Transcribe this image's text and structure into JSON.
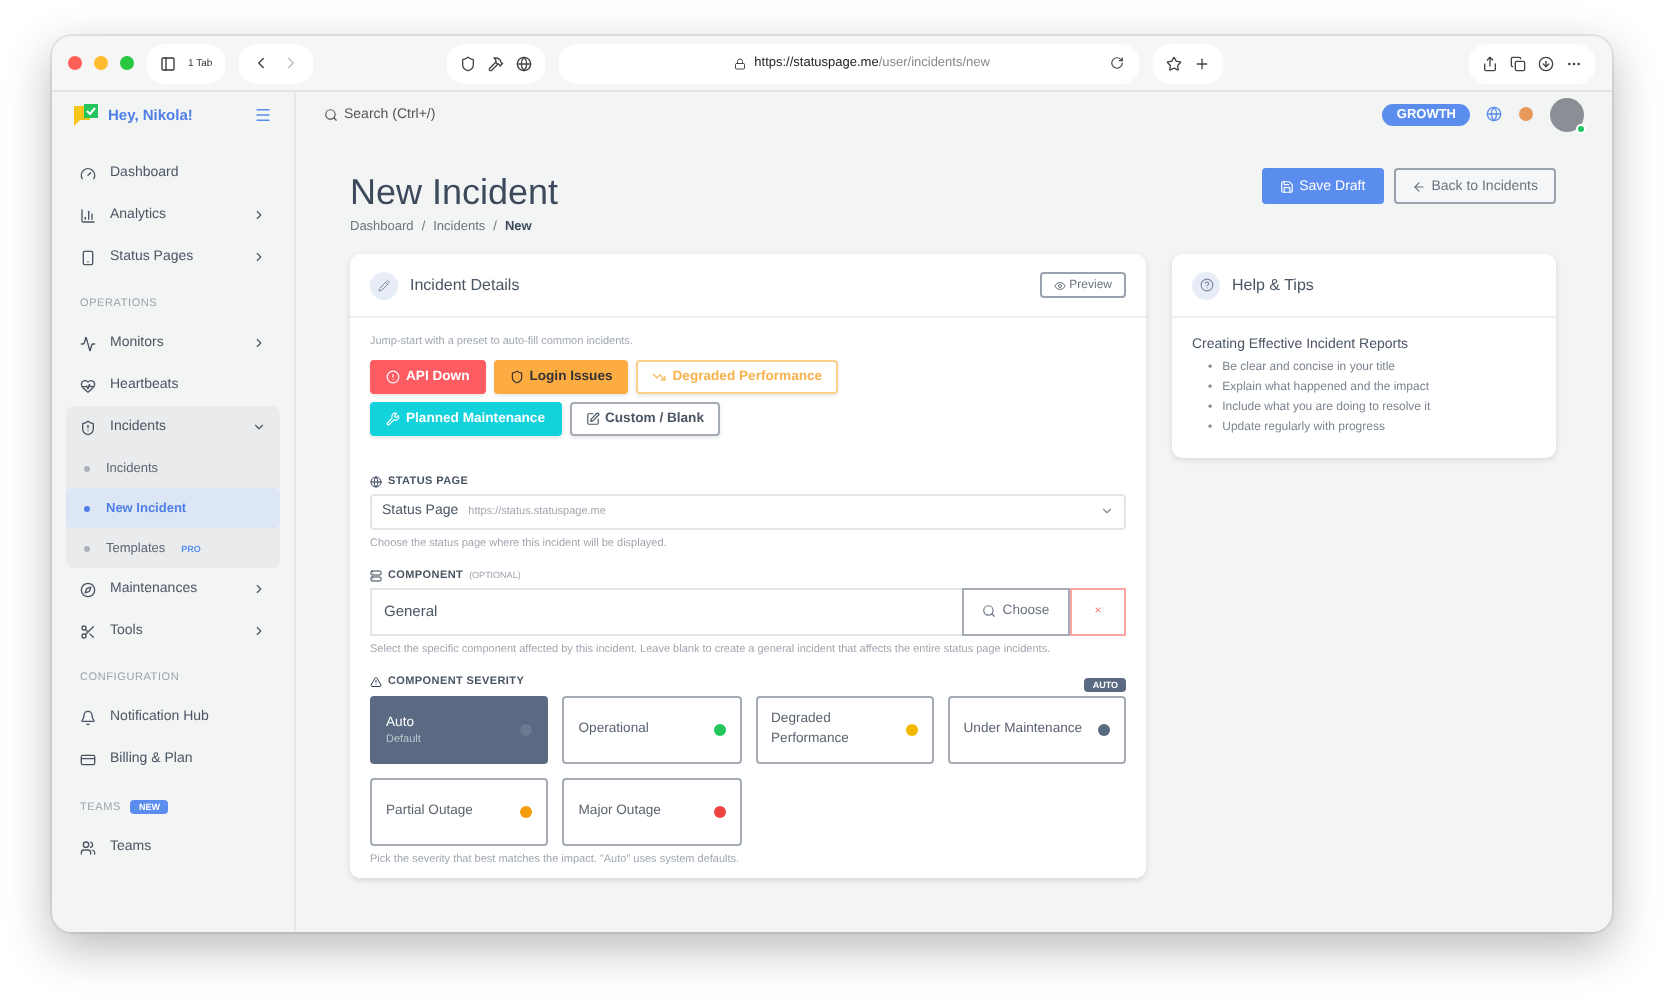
{
  "browser": {
    "tab_count": "1 Tab",
    "url_host": "https://statuspage.me",
    "url_path": "/user/incidents/new"
  },
  "sidebar": {
    "greeting": "Hey, Nikola!",
    "groups": [
      {
        "items": [
          {
            "label": "Dashboard",
            "expandable": false,
            "selected": false
          },
          {
            "label": "Analytics",
            "expandable": true,
            "expanded": false,
            "selected": false
          },
          {
            "label": "Status Pages",
            "expandable": true,
            "expanded": false,
            "selected": false
          }
        ]
      },
      {
        "heading": "OPERATIONS",
        "items": [
          {
            "label": "Monitors",
            "expandable": true,
            "expanded": false,
            "selected": false
          },
          {
            "label": "Heartbeats",
            "expandable": false,
            "selected": false
          },
          {
            "label": "Incidents",
            "expandable": true,
            "expanded": true,
            "selected": false,
            "children": [
              {
                "label": "Incidents",
                "selected": false
              },
              {
                "label": "New Incident",
                "selected": true
              },
              {
                "label": "Templates",
                "badge": "PRO",
                "selected": false
              }
            ]
          },
          {
            "label": "Maintenances",
            "expandable": true,
            "expanded": false,
            "selected": false
          },
          {
            "label": "Tools",
            "expandable": true,
            "expanded": false,
            "selected": false
          }
        ]
      },
      {
        "heading": "CONFIGURATION",
        "items": [
          {
            "label": "Notification Hub",
            "expandable": false,
            "selected": false
          },
          {
            "label": "Billing & Plan",
            "expandable": false,
            "selected": false
          }
        ]
      },
      {
        "heading": "TEAMS",
        "badge": "NEW",
        "items": [
          {
            "label": "Teams",
            "expandable": false,
            "selected": false
          }
        ]
      }
    ]
  },
  "topbar": {
    "search": {
      "placeholder": "Search (Ctrl+/)"
    },
    "plan": "GROWTH"
  },
  "page": {
    "title": "New Incident",
    "breadcrumbs": [
      "Dashboard",
      "Incidents",
      "New"
    ],
    "breadcrumb_separator": "/",
    "actions": [
      "Save Draft",
      "Back to Incidents"
    ]
  },
  "details": {
    "title": "Incident Details",
    "preview": "Preview",
    "preset_hint": "Jump-start with a preset to auto-fill common incidents.",
    "presets": [
      {
        "label": "API Down",
        "kind": "danger"
      },
      {
        "label": "Login Issues",
        "kind": "warning"
      },
      {
        "label": "Degraded Performance",
        "kind": "outline"
      },
      {
        "label": "Planned Maintenance",
        "kind": "info"
      },
      {
        "label": "Custom / Blank",
        "kind": "plain"
      }
    ],
    "status_page": {
      "label": "STATUS PAGE",
      "value": "Status Page",
      "url": "https://status.statuspage.me",
      "hint": "Choose the status page where this incident will be displayed."
    },
    "component": {
      "label": "COMPONENT",
      "optional": "(OPTIONAL)",
      "value": "General",
      "choose": "Choose",
      "clear": "×",
      "hint": "Select the specific component affected by this incident. Leave blank to create a general incident that affects the entire status page incidents."
    },
    "severity": {
      "label": "COMPONENT SEVERITY",
      "badge": "AUTO",
      "options": [
        {
          "label": "Auto",
          "sublabel": "Default",
          "color": "#6b7a90",
          "selected": true
        },
        {
          "label": "Operational",
          "color": "#22c55e",
          "selected": false
        },
        {
          "label": "Degraded Performance",
          "color": "#f5b800",
          "selected": false
        },
        {
          "label": "Under Maintenance",
          "color": "#5a6a7e",
          "selected": false
        },
        {
          "label": "Partial Outage",
          "color": "#f59e0b",
          "selected": false
        },
        {
          "label": "Major Outage",
          "color": "#ef4444",
          "selected": false
        }
      ],
      "hint": "Pick the severity that best matches the impact. \"Auto\" uses system defaults."
    }
  },
  "help": {
    "title": "Help & Tips",
    "heading": "Creating Effective Incident Reports",
    "bullet": "•",
    "tips": [
      "Be clear and concise in your title",
      "Explain what happened and the impact",
      "Include what you are doing to resolve it",
      "Update regularly with progress"
    ]
  }
}
